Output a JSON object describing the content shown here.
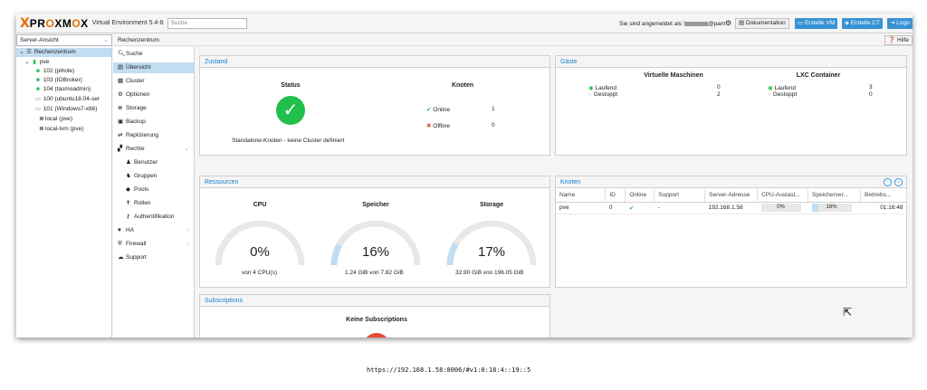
{
  "header": {
    "logo_x": "X",
    "logo_pre": "PR",
    "logo_o1": "O",
    "logo_mid": "XM",
    "logo_o2": "O",
    "logo_end": "X",
    "version": "Virtual Environment 5.4-8",
    "search_placeholder": "Suche",
    "login_prefix": "Sie sind angemeldet als '",
    "login_suffix": "@pam'",
    "docs_label": "Dokumentation",
    "create_vm_label": "Erstelle VM",
    "create_ct_label": "Erstelle CT",
    "logout_label": "Logo",
    "help_label": "Hilfe"
  },
  "view_selector": {
    "value": "Server-Ansicht"
  },
  "breadcrumb": "Rechenzentrum",
  "tree": {
    "root": "Rechenzentrum",
    "node": "pve",
    "items": [
      {
        "label": "102 (pihole)",
        "icon": "container-running-icon"
      },
      {
        "label": "103 (IOBroker)",
        "icon": "container-running-icon"
      },
      {
        "label": "104 (tasmoadmin)",
        "icon": "container-running-icon"
      },
      {
        "label": "100 (ubuntu18.04-ser",
        "icon": "vm-stopped-icon"
      },
      {
        "label": "101 (Windows7-x86)",
        "icon": "vm-stopped-icon"
      },
      {
        "label": "local (pve)",
        "icon": "storage-icon"
      },
      {
        "label": "local-lvm (pve)",
        "icon": "storage-icon"
      }
    ]
  },
  "menu": {
    "items": [
      {
        "label": "Suche"
      },
      {
        "label": "Übersicht"
      },
      {
        "label": "Cluster"
      },
      {
        "label": "Optionen"
      },
      {
        "label": "Storage"
      },
      {
        "label": "Backup"
      },
      {
        "label": "Replizierung"
      },
      {
        "label": "Rechte"
      },
      {
        "label": "Benutzer"
      },
      {
        "label": "Gruppen"
      },
      {
        "label": "Pools"
      },
      {
        "label": "Rollen"
      },
      {
        "label": "Authentifikation"
      },
      {
        "label": "HA"
      },
      {
        "label": "Firewall"
      },
      {
        "label": "Support"
      }
    ]
  },
  "status_panel": {
    "title": "Zustand",
    "status_heading": "Status",
    "nodes_heading": "Knoten",
    "online_label": "Online",
    "online_count": "1",
    "offline_label": "Offline",
    "offline_count": "0",
    "description": "Standalone-Knoten - keine Cluster definiert"
  },
  "guests_panel": {
    "title": "Gäste",
    "vm_heading": "Virtuelle Maschinen",
    "lxc_heading": "LXC Container",
    "vm_running_label": "Laufend",
    "vm_running": "0",
    "vm_stopped_label": "Gestoppt",
    "vm_stopped": "2",
    "lxc_running_label": "Laufend",
    "lxc_running": "3",
    "lxc_stopped_label": "Gestoppt",
    "lxc_stopped": "0"
  },
  "resources_panel": {
    "title": "Ressourcen",
    "cpu": {
      "label": "CPU",
      "value": "0%",
      "fraction": 0.0,
      "detail": "von 4 CPU(s)"
    },
    "memory": {
      "label": "Speicher",
      "value": "16%",
      "fraction": 0.16,
      "detail": "1.24 GiB von 7.82 GiB"
    },
    "storage": {
      "label": "Storage",
      "value": "17%",
      "fraction": 0.17,
      "detail": "32.90 GiB von 196.05 GiB"
    }
  },
  "nodes_panel": {
    "title": "Knoten",
    "columns": [
      "Name",
      "ID",
      "Online",
      "Support",
      "Server-Adresse",
      "CPU-Auslast...",
      "Speicherver...",
      "Betriebs..."
    ],
    "rows": [
      {
        "name": "pve",
        "id": "0",
        "support": "-",
        "address": "192.168.1.58",
        "cpu": "0%",
        "cpu_fraction": 0.0,
        "mem": "16%",
        "mem_fraction": 0.16,
        "uptime": "01:16:48"
      }
    ]
  },
  "subscriptions_panel": {
    "title": "Subscriptions",
    "heading": "Keine Subscriptions"
  },
  "footer_url": "https://192.168.1.58:8006/#v1:0:18:4::19::5",
  "colors": {
    "accent": "#3892d4",
    "title_blue": "#157fcc",
    "ok_green": "#21bf4b",
    "error_red": "#e34a35",
    "logo_orange": "#e57000",
    "selection": "#c1ddf1"
  }
}
